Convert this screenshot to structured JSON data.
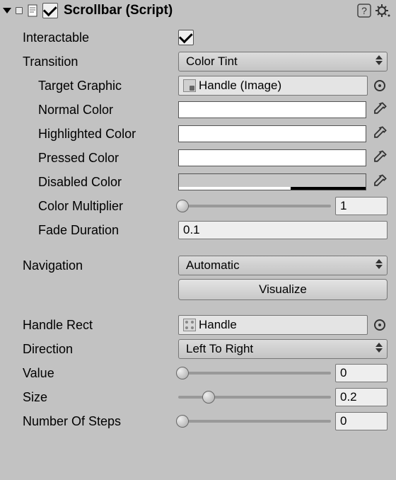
{
  "header": {
    "title": "Scrollbar (Script)",
    "enabled": true
  },
  "labels": {
    "interactable": "Interactable",
    "transition": "Transition",
    "target_graphic": "Target Graphic",
    "normal_color": "Normal Color",
    "highlighted_color": "Highlighted Color",
    "pressed_color": "Pressed Color",
    "disabled_color": "Disabled Color",
    "color_multiplier": "Color Multiplier",
    "fade_duration": "Fade Duration",
    "navigation": "Navigation",
    "visualize": "Visualize",
    "handle_rect": "Handle Rect",
    "direction": "Direction",
    "value": "Value",
    "size": "Size",
    "number_of_steps": "Number Of Steps"
  },
  "values": {
    "interactable": true,
    "transition": "Color Tint",
    "target_graphic": "Handle (Image)",
    "normal_color": "#ffffff",
    "highlighted_color": "#ffffff",
    "pressed_color": "#ffffff",
    "disabled_color": "#c8c8c8",
    "disabled_alpha_pct": 60,
    "color_multiplier": "1",
    "color_multiplier_pct": 0,
    "fade_duration": "0.1",
    "navigation": "Automatic",
    "handle_rect": "Handle",
    "direction": "Left To Right",
    "value": "0",
    "value_pct": 0,
    "size": "0.2",
    "size_pct": 20,
    "number_of_steps": "0",
    "number_of_steps_pct": 0
  }
}
